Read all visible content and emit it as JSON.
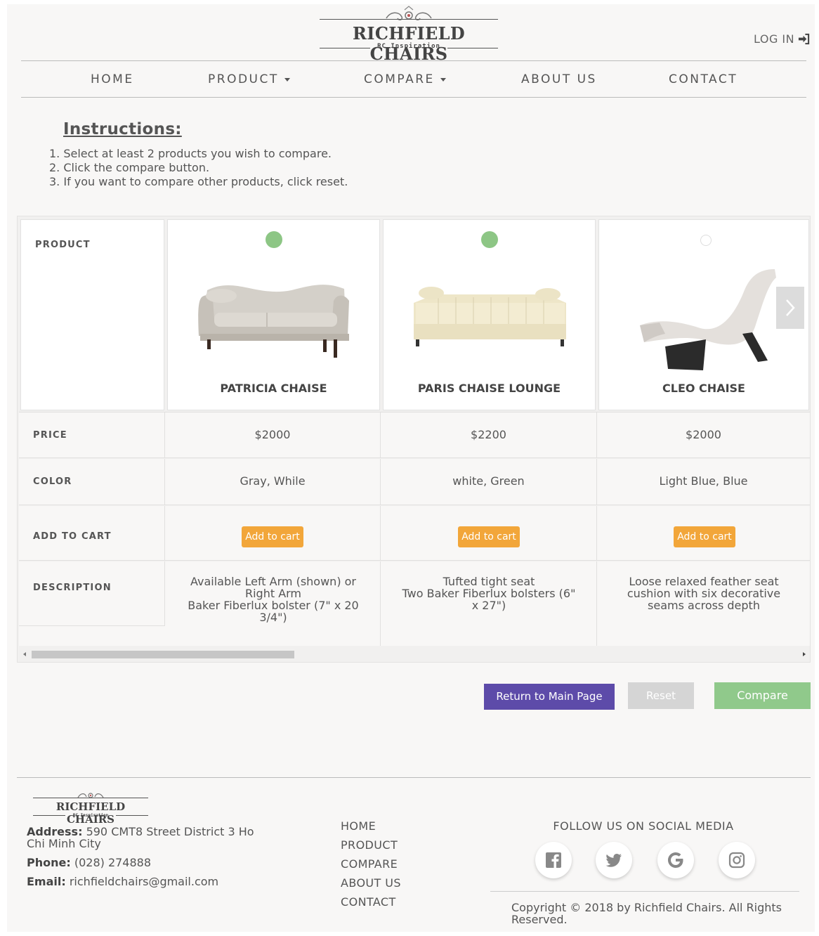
{
  "brand": {
    "name": "RICHFIELD CHAIRS",
    "tagline": "RC Inspiration"
  },
  "header": {
    "login_label": "LOG IN"
  },
  "nav": {
    "items": [
      {
        "label": "HOME"
      },
      {
        "label": "PRODUCT"
      },
      {
        "label": "COMPARE"
      },
      {
        "label": "ABOUT US"
      },
      {
        "label": "CONTACT"
      }
    ]
  },
  "instructions": {
    "title": "Instructions:",
    "steps": [
      "1. Select at least 2 products you wish to compare.",
      "2. Click the compare button.",
      "3. If you want to compare other products, click reset."
    ]
  },
  "compare": {
    "row_labels": {
      "product": "PRODUCT",
      "price": "PRICE",
      "color": "COLOR",
      "add_to_cart": "ADD TO CART",
      "description": "DESCRIPTION"
    },
    "add_to_cart_label": "Add to cart",
    "products": [
      {
        "name": "PATRICIA CHAISE",
        "selected": true,
        "price": "$2000",
        "color": "Gray, While",
        "description": [
          "Available Left Arm (shown) or",
          "Right Arm",
          "Baker Fiberlux bolster (7\" x 20",
          "3/4\")"
        ]
      },
      {
        "name": "PARIS CHAISE LOUNGE",
        "selected": true,
        "price": "$2200",
        "color": "white, Green",
        "description": [
          "Tufted tight seat",
          "Two Baker Fiberlux bolsters (6\"",
          "x 27\")"
        ]
      },
      {
        "name": "CLEO CHAISE",
        "selected": false,
        "price": "$2000",
        "color": "Light Blue, Blue",
        "description": [
          "Loose relaxed feather seat",
          "cushion with six decorative",
          "seams across depth"
        ]
      }
    ]
  },
  "actions": {
    "return_label": "Return to Main Page",
    "reset_label": "Reset",
    "compare_label": "Compare"
  },
  "footer": {
    "address_label": "Address:",
    "address_value": " 590 CMT8 Street District 3 Ho Chi Minh City",
    "phone_label": "Phone:",
    "phone_value": " (028) 274888",
    "email_label": "Email:",
    "email_value": " richfieldchairs@gmail.com",
    "links": [
      "HOME",
      "PRODUCT",
      "COMPARE",
      "ABOUT US",
      "CONTACT"
    ],
    "follow_label": "FOLLOW US ON SOCIAL MEDIA",
    "social": [
      "facebook-icon",
      "twitter-icon",
      "google-icon",
      "instagram-icon"
    ],
    "copyright": "Copyright © 2018 by Richfield Chairs. All Rights Reserved."
  },
  "colors": {
    "selected_radio": "#8dc685",
    "add_to_cart": "#f2a63a",
    "return_button": "#5d4ba9",
    "reset_button": "#d5d5d5",
    "compare_button": "#90c98b"
  }
}
